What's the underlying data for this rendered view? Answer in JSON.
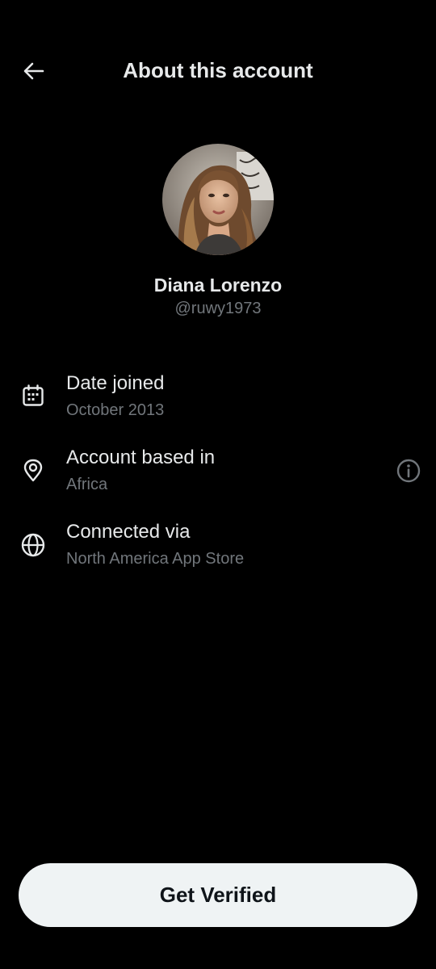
{
  "header": {
    "title": "About this account",
    "back_icon": "arrow-left-icon"
  },
  "profile": {
    "display_name": "Diana Lorenzo",
    "handle": "@ruwy1973",
    "avatar": "profile-photo"
  },
  "info_rows": [
    {
      "icon": "calendar-icon",
      "label": "Date joined",
      "value": "October 2013"
    },
    {
      "icon": "location-pin-icon",
      "label": "Account based in",
      "value": "Africa",
      "action_icon": "info-circle-icon"
    },
    {
      "icon": "globe-icon",
      "label": "Connected via",
      "value": "North America App Store"
    }
  ],
  "footer": {
    "button_label": "Get Verified"
  },
  "colors": {
    "background": "#000000",
    "primary_text": "#e7e9ea",
    "secondary_text": "#71767b",
    "button_bg": "#eff3f4",
    "button_text": "#0f1419"
  }
}
